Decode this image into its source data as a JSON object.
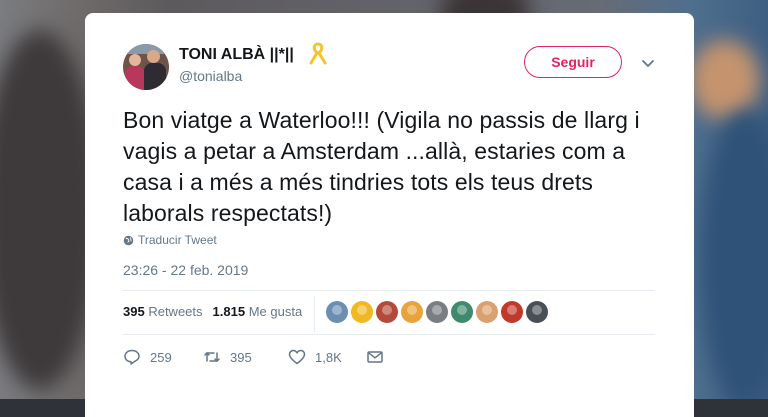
{
  "tweet": {
    "author_name": "TONI ALBÀ ||*||",
    "author_handle": "@tonialba",
    "follow_label": "Seguir",
    "text": "Bon viatge a Waterloo!!! (Vigila no passis de llarg i vagis a petar a Amsterdam ...allà, estaries com a casa i a més a més tindries tots els teus drets laborals respectats!)",
    "translate_label": "Traducir Tweet",
    "timestamp": "23:26 - 22 feb. 2019",
    "stats": {
      "retweets_count": "395",
      "retweets_label": "Retweets",
      "likes_count": "1.815",
      "likes_label": "Me gusta"
    },
    "actions": {
      "reply_count": "259",
      "retweet_count": "395",
      "like_count": "1,8K"
    }
  },
  "colors": {
    "accent": "#e0245e",
    "text_primary": "#14171a",
    "text_secondary": "#657786",
    "ribbon": "#f4c430"
  },
  "likers": [
    {
      "color": "#6b8fb3"
    },
    {
      "color": "#f0b923"
    },
    {
      "color": "#b34a3a"
    },
    {
      "color": "#e8a33b"
    },
    {
      "color": "#7a7d82"
    },
    {
      "color": "#3f8a6c"
    },
    {
      "color": "#d9a070"
    },
    {
      "color": "#c0392b"
    },
    {
      "color": "#4a4f57"
    }
  ]
}
